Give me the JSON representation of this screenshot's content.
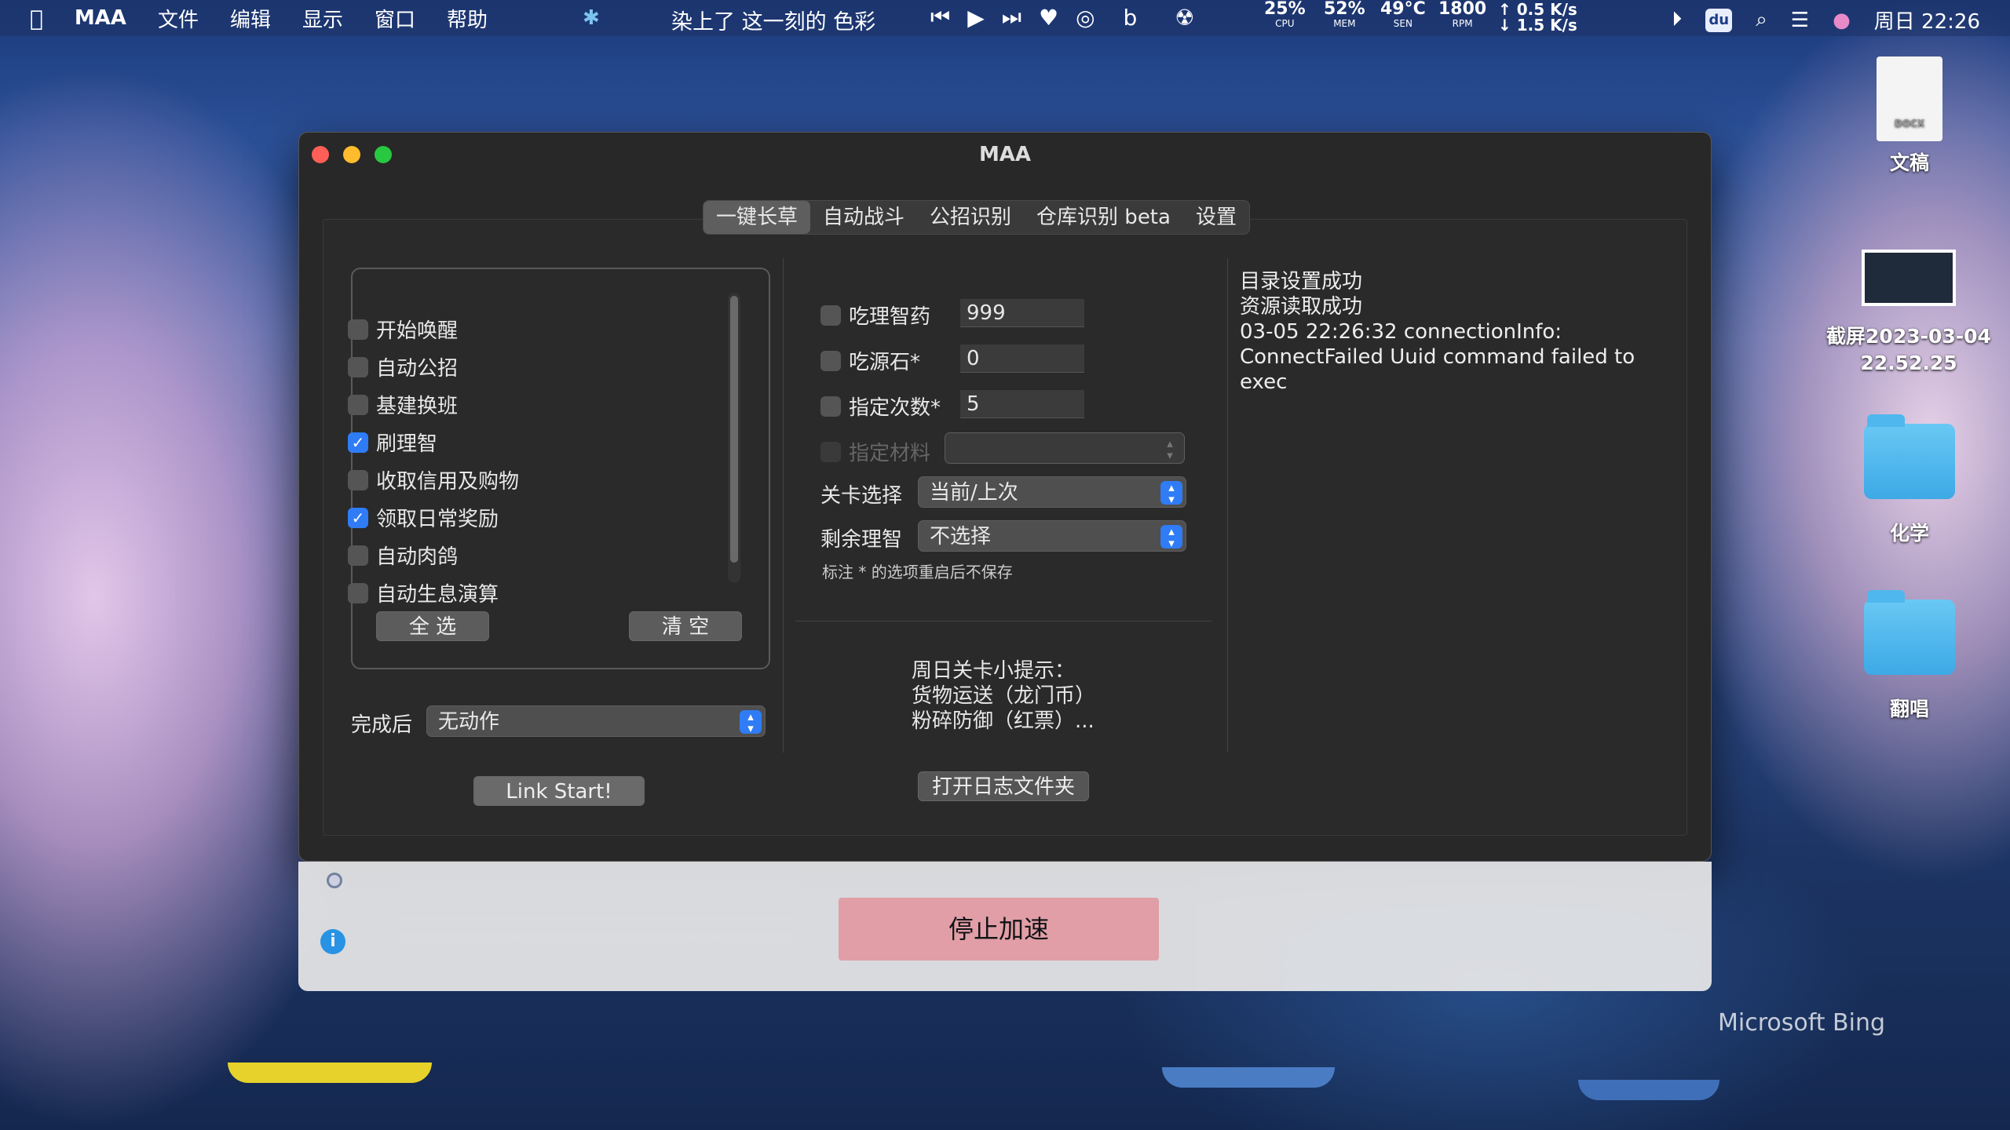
{
  "menubar": {
    "app": "MAA",
    "items": [
      "文件",
      "编辑",
      "显示",
      "窗口",
      "帮助"
    ],
    "song": "染上了 这一刻的 色彩",
    "stats": [
      {
        "v": "25%",
        "l": "CPU"
      },
      {
        "v": "52%",
        "l": "MEM"
      },
      {
        "v": "49°C",
        "l": "SEN"
      },
      {
        "v": "1800",
        "l": "RPM"
      }
    ],
    "net_up": "↑ 0.5 K/s",
    "net_down": "↓ 1.5 K/s",
    "clock": "周日  22:26",
    "tile_label": "du"
  },
  "desktop": {
    "items": [
      {
        "label": "文稿"
      },
      {
        "label": "截屏2023-03-04 22.52.25"
      },
      {
        "label": "化学"
      },
      {
        "label": "翻唱"
      }
    ],
    "docx_tag": "DOCX",
    "watermark": "Microsoft Bing"
  },
  "window": {
    "title": "MAA",
    "tabs": [
      "一键长草",
      "自动战斗",
      "公招识别",
      "仓库识别 beta",
      "设置"
    ],
    "tasks": [
      {
        "label": "开始唤醒",
        "checked": false
      },
      {
        "label": "自动公招",
        "checked": false
      },
      {
        "label": "基建换班",
        "checked": false
      },
      {
        "label": "刷理智",
        "checked": true
      },
      {
        "label": "收取信用及购物",
        "checked": false
      },
      {
        "label": "领取日常奖励",
        "checked": true
      },
      {
        "label": "自动肉鸽",
        "checked": false
      },
      {
        "label": "自动生息演算",
        "checked": false
      }
    ],
    "select_all": "全 选",
    "clear": "清 空",
    "after_label": "完成后",
    "after_value": "无动作",
    "link_start": "Link Start!",
    "options": [
      {
        "label": "吃理智药",
        "value": "999"
      },
      {
        "label": "吃源石*",
        "value": "0"
      },
      {
        "label": "指定次数*",
        "value": "5"
      }
    ],
    "material_label": "指定材料",
    "stage_label": "关卡选择",
    "stage_value": "当前/上次",
    "remain_label": "剩余理智",
    "remain_value": "不选择",
    "note": "标注 * 的选项重启后不保存",
    "tip": [
      "周日关卡小提示：",
      "货物运送（龙门币）",
      "粉碎防御（红票）..."
    ],
    "open_log": "打开日志文件夹",
    "log": [
      "目录设置成功",
      "资源读取成功",
      "03-05 22:26:32 connectionInfo: ConnectFailed Uuid command failed to exec"
    ]
  },
  "overlay": {
    "stop": "停止加速"
  }
}
